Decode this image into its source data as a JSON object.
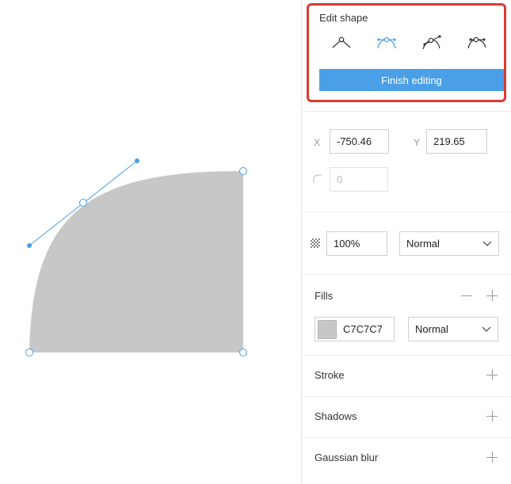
{
  "edit_shape": {
    "title": "Edit shape",
    "tools": [
      {
        "icon": "straight-point-icon"
      },
      {
        "icon": "mirrored-point-icon"
      },
      {
        "icon": "disconnected-point-icon"
      },
      {
        "icon": "asymmetric-point-icon"
      }
    ],
    "finish_label": "Finish editing"
  },
  "position": {
    "x_label": "X",
    "x_value": "-750.46",
    "y_label": "Y",
    "y_value": "219.65",
    "radius_icon": "corner-radius-icon",
    "radius_value": "0"
  },
  "appearance": {
    "opacity_icon": "opacity-checker-icon",
    "opacity_value": "100%",
    "blend_mode": "Normal"
  },
  "fills": {
    "title": "Fills",
    "color_hex": "C7C7C7",
    "swatch_color": "#c7c7c7",
    "blend_mode": "Normal"
  },
  "stroke": {
    "title": "Stroke"
  },
  "shadows": {
    "title": "Shadows"
  },
  "blur": {
    "title": "Gaussian blur"
  },
  "colors": {
    "accent": "#4a9fe7",
    "highlight_border": "#d93a32",
    "shape_fill": "#c7c7c7"
  }
}
